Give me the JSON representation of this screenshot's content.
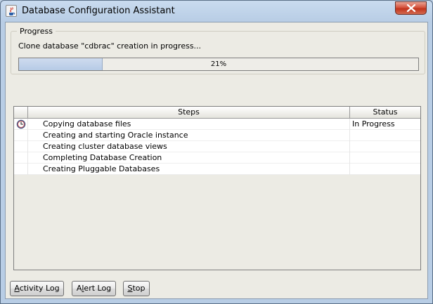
{
  "window": {
    "title": "Database Configuration Assistant",
    "icon": "java-cup-icon",
    "close_icon": "close-icon"
  },
  "progress": {
    "legend": "Progress",
    "message": "Clone database \"cdbrac\" creation in progress...",
    "percent": 21,
    "percent_label": "21%"
  },
  "table": {
    "columns": [
      "Steps",
      "Status"
    ],
    "rows": [
      {
        "icon": "clock-icon",
        "step": "Copying database files",
        "status": "In Progress"
      },
      {
        "icon": "",
        "step": "Creating and starting Oracle instance",
        "status": ""
      },
      {
        "icon": "",
        "step": "Creating cluster database views",
        "status": ""
      },
      {
        "icon": "",
        "step": "Completing Database Creation",
        "status": ""
      },
      {
        "icon": "",
        "step": "Creating Pluggable Databases",
        "status": ""
      }
    ]
  },
  "buttons": {
    "activity_log": {
      "mnemonic": "A",
      "rest": "ctivity Log"
    },
    "alert_log": {
      "pre": "A",
      "mnemonic": "l",
      "rest": "ert Log"
    },
    "stop": {
      "mnemonic": "S",
      "rest": "top"
    }
  },
  "colors": {
    "progress_fill": "#b6cbe6",
    "close_button": "#c1331c",
    "client_bg": "#ecebe4"
  }
}
